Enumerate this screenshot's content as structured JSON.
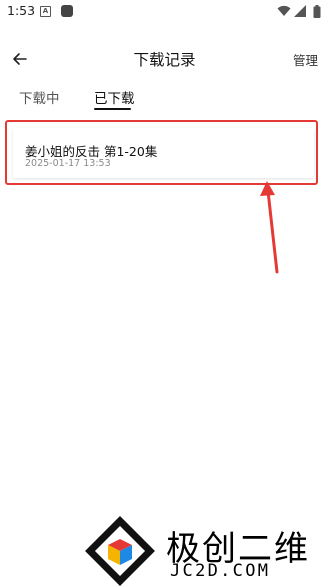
{
  "status_bar": {
    "time": "1:53",
    "a_icon_letter": "A"
  },
  "header": {
    "title": "下载记录",
    "manage_label": "管理"
  },
  "tabs": [
    {
      "label": "下载中",
      "selected": false
    },
    {
      "label": "已下载",
      "selected": true
    }
  ],
  "downloads": [
    {
      "title": "姜小姐的反击 第1-20集",
      "date": "2025-01-17 13:53"
    }
  ],
  "watermark": {
    "cn": "极创二维",
    "en": "JC2D.COM"
  },
  "colors": {
    "annotation": "#e53935",
    "accent": "#111111"
  },
  "icons": [
    "back-arrow-icon",
    "wifi-icon",
    "signal-icon",
    "battery-icon"
  ]
}
